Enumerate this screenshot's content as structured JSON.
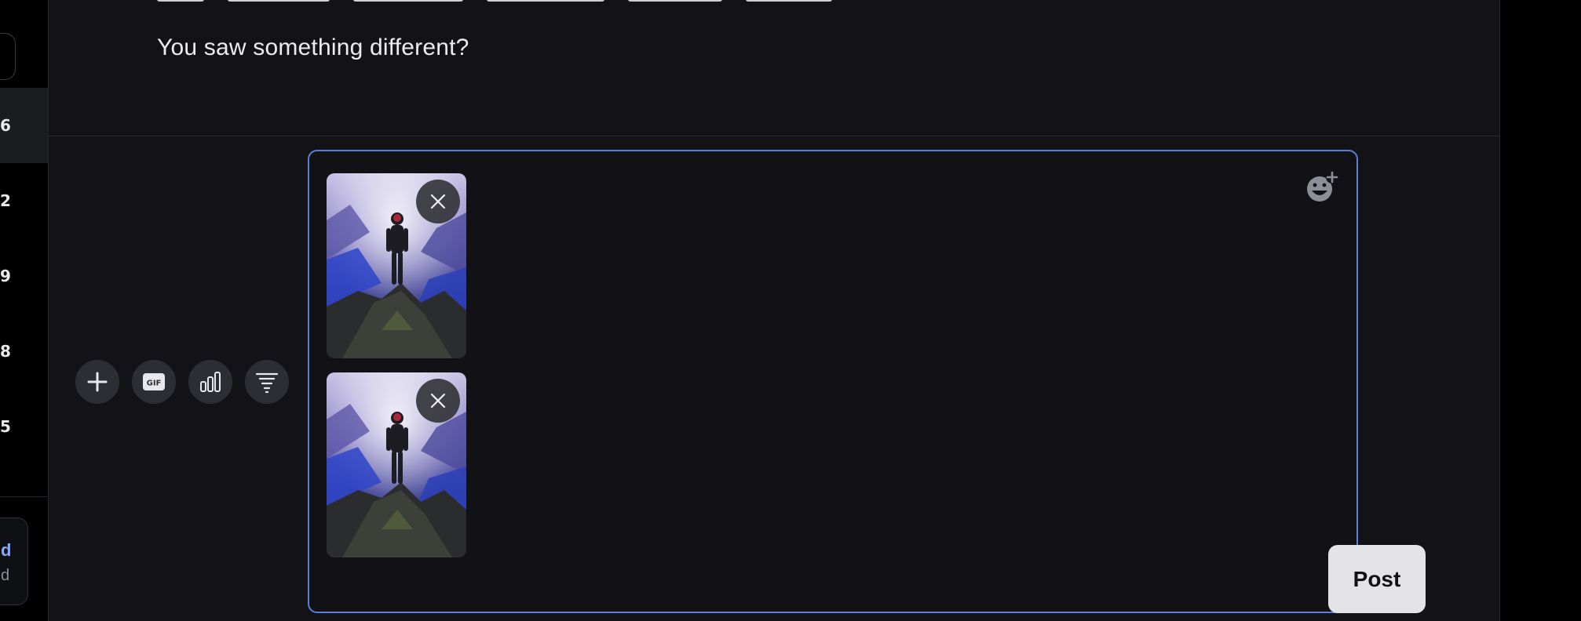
{
  "sidebar": {
    "items": [
      {
        "label": "6",
        "active": true
      },
      {
        "label": "2",
        "active": false
      },
      {
        "label": "9",
        "active": false
      },
      {
        "label": "8",
        "active": false
      },
      {
        "label": "5",
        "active": false
      }
    ],
    "card": {
      "title": "d",
      "subtitle": "d"
    }
  },
  "post": {
    "text": "You saw something different?"
  },
  "composer": {
    "toolbar": [
      {
        "name": "add-media-button",
        "icon": "plus-icon"
      },
      {
        "name": "gif-button",
        "icon": "gif-icon",
        "badge": "GIF"
      },
      {
        "name": "poll-button",
        "icon": "bar-chart-icon"
      },
      {
        "name": "filter-button",
        "icon": "filter-icon"
      }
    ],
    "emoji_icon": "emoji-add-icon",
    "attachments": [
      {
        "name": "attachment-1",
        "remove_icon": "close-icon"
      },
      {
        "name": "attachment-2",
        "remove_icon": "close-icon"
      }
    ],
    "post_label": "Post"
  },
  "colors": {
    "background": "#000000",
    "panel": "#131317",
    "composer_border": "#5a7fd9",
    "accent_link": "#8aa8ff",
    "button_bg": "#2d2e33",
    "post_button_bg": "#e4e4e8"
  }
}
